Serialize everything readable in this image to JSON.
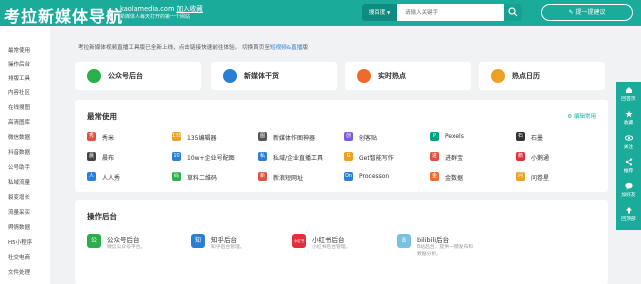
{
  "header": {
    "logo": "考拉新媒体导航",
    "site_url": "kaolamedia.com",
    "bookmark": "加入收藏",
    "slogan": "新媒体人每天打开的第一个网站",
    "search_type": "搜百度",
    "search_placeholder": "请输入关键字",
    "suggest": "提一提建议"
  },
  "sidebar": {
    "items": [
      "最常使用",
      "操作后台",
      "排版工具",
      "内容社区",
      "在线搜图",
      "高清图库",
      "微信数据",
      "抖音数据",
      "公号助手",
      "私域流量",
      "裂变增长",
      "流量采买",
      "舆情数据",
      "H5小程序",
      "社交电商",
      "文件处理"
    ]
  },
  "notice": {
    "text": "考拉新媒体视频直播工具版已全新上线，点击链接快速前往体验。 切换首页至",
    "link": "短视频&直播",
    "tail": "版"
  },
  "quick_links": [
    {
      "label": "公众号后台",
      "color": "#2ab04a"
    },
    {
      "label": "新媒体干货",
      "color": "#2a7fd4"
    },
    {
      "label": "实时热点",
      "color": "#f06a2a"
    },
    {
      "label": "热点日历",
      "color": "#f0a020"
    }
  ],
  "common": {
    "title": "最常使用",
    "edit": "编辑常用",
    "tools": [
      {
        "label": "秀米",
        "icon": "秀",
        "color": "#e0503c"
      },
      {
        "label": "135编辑器",
        "icon": "135",
        "color": "#f0a020"
      },
      {
        "label": "新媒体作图神器",
        "icon": "图",
        "color": "#555555"
      },
      {
        "label": "创客贴",
        "icon": "创",
        "color": "#7a5ae0"
      },
      {
        "label": "Pexels",
        "icon": "P",
        "color": "#05a081"
      },
      {
        "label": "石墨",
        "icon": "石",
        "color": "#333333"
      },
      {
        "label": "晨布",
        "icon": "晨",
        "color": "#444444"
      },
      {
        "label": "10w+企业号配图",
        "icon": "10",
        "color": "#2a7fd4"
      },
      {
        "label": "私域/企业直播工具",
        "icon": "私",
        "color": "#2a7fd4"
      },
      {
        "label": "Get智能写作",
        "icon": "G",
        "color": "#f0a020"
      },
      {
        "label": "进群宝",
        "icon": "进",
        "color": "#e0503c"
      },
      {
        "label": "小鹅通",
        "icon": "鹅",
        "color": "#e0303c"
      },
      {
        "label": "人人秀",
        "icon": "人",
        "color": "#2a7fd4"
      },
      {
        "label": "草料二维码",
        "icon": "码",
        "color": "#2ab04a"
      },
      {
        "label": "新浪短网址",
        "icon": "新",
        "color": "#e0503c"
      },
      {
        "label": "Processon",
        "icon": "On",
        "color": "#2a7fd4"
      },
      {
        "label": "金数据",
        "icon": "金",
        "color": "#f06a2a"
      },
      {
        "label": "问卷星",
        "icon": "问",
        "color": "#f0a020"
      }
    ]
  },
  "backend": {
    "title": "操作后台",
    "items": [
      {
        "name": "公众号后台",
        "desc": "微信公众号平台。",
        "icon": "公",
        "color": "#2ab04a"
      },
      {
        "name": "知乎后台",
        "desc": "知乎后台管理。",
        "icon": "知",
        "color": "#2a7fd4"
      },
      {
        "name": "小红书后台",
        "desc": "小红书后台管理。",
        "icon": "小红书",
        "color": "#e0303c"
      },
      {
        "name": "bilibili后台",
        "desc": "B站后台，提供一键发布和数据分析。",
        "icon": "B",
        "color": "#7ac0e0"
      }
    ]
  },
  "right_bar": {
    "items": [
      "回首页",
      "收藏",
      "关注",
      "推荐",
      "加好友",
      "回顶部"
    ]
  }
}
